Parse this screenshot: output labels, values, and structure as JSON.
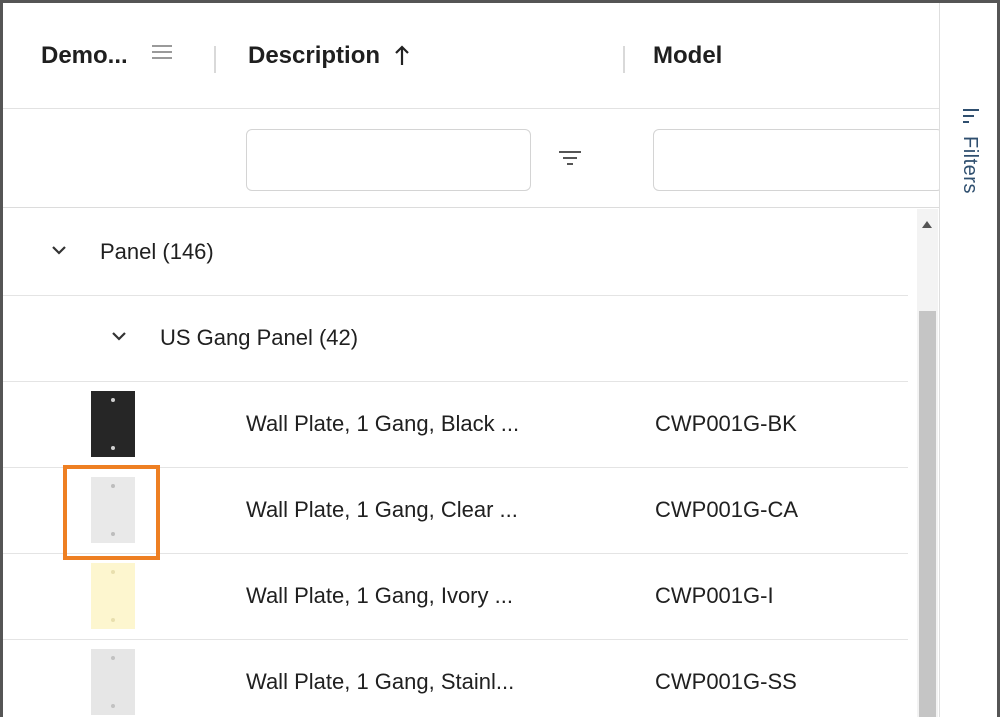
{
  "header": {
    "col_demo": "Demo...",
    "col_description": "Description",
    "col_model": "Model",
    "sort_direction": "ascending",
    "icons": {
      "column_menu": "menu-icon",
      "sort": "arrow-up-icon",
      "filter": "filter-icon"
    }
  },
  "filters": {
    "description_value": "",
    "model_value": ""
  },
  "groups": [
    {
      "label": "Panel (146)",
      "expanded": true
    },
    {
      "label": "US Gang Panel (42)",
      "expanded": true
    }
  ],
  "rows": [
    {
      "description": "Wall Plate, 1 Gang, Black ...",
      "model": "CWP001G-BK",
      "thumb_color": "#262626",
      "screw_color": "#cfcfcf"
    },
    {
      "description": "Wall Plate, 1 Gang, Clear ...",
      "model": "CWP001G-CA",
      "thumb_color": "#e9e9e9",
      "screw_color": "#bdbdbd"
    },
    {
      "description": "Wall Plate, 1 Gang, Ivory ...",
      "model": "CWP001G-I",
      "thumb_color": "#fdf6cf",
      "screw_color": "#e8dfae"
    },
    {
      "description": "Wall Plate, 1 Gang, Stainl...",
      "model": "CWP001G-SS",
      "thumb_color": "#e6e6e6",
      "screw_color": "#c2c2c2"
    }
  ],
  "side_panel": {
    "filters_label": "Filters"
  },
  "colors": {
    "highlight": "#ee7f22",
    "side_label": "#2f4f6f",
    "scroll_thumb": "#c5c5c5"
  }
}
